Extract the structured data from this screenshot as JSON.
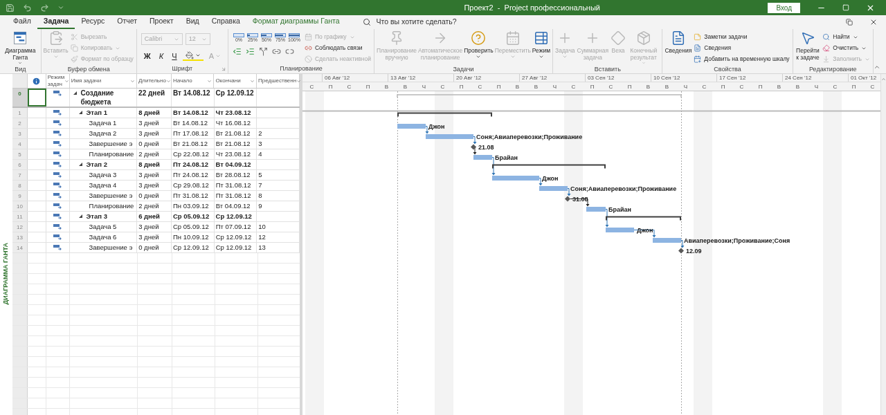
{
  "window": {
    "title": "Проект2  -  Project профессиональный",
    "sign_in": "Вход"
  },
  "tabs": [
    {
      "label": "Файл",
      "selected": false,
      "kind": "normal"
    },
    {
      "label": "Задача",
      "selected": true,
      "kind": "normal"
    },
    {
      "label": "Ресурс",
      "selected": false,
      "kind": "normal"
    },
    {
      "label": "Отчет",
      "selected": false,
      "kind": "normal"
    },
    {
      "label": "Проект",
      "selected": false,
      "kind": "normal"
    },
    {
      "label": "Вид",
      "selected": false,
      "kind": "normal"
    },
    {
      "label": "Справка",
      "selected": false,
      "kind": "normal"
    },
    {
      "label": "Формат диаграммы Ганта",
      "selected": false,
      "kind": "contextual"
    }
  ],
  "search": {
    "placeholder": "Что вы хотите сделать?"
  },
  "ribbon": {
    "groups": [
      {
        "label": "Вид",
        "items": [
          {
            "kind": "large",
            "label": "Диаграмма Ганта",
            "dropdown": true,
            "disabled": false
          }
        ]
      },
      {
        "label": "Буфер обмена",
        "items": [
          {
            "kind": "large",
            "label": "Вставить",
            "dropdown": true,
            "disabled": true
          },
          {
            "kind": "small",
            "label": "Вырезать",
            "disabled": true
          },
          {
            "kind": "small",
            "label": "Копировать",
            "dropdown": true,
            "disabled": true
          },
          {
            "kind": "small",
            "label": "Формат по образцу",
            "disabled": true
          }
        ]
      },
      {
        "label": "Шрифт",
        "launcher": true,
        "items": [
          {
            "kind": "select",
            "value": "Calibri",
            "disabled": true
          },
          {
            "kind": "select",
            "value": "12",
            "disabled": true
          },
          {
            "kind": "format",
            "label": "Ж",
            "disabled": false
          },
          {
            "kind": "format",
            "label": "К",
            "disabled": false
          },
          {
            "kind": "format",
            "label": "Ч",
            "disabled": false
          },
          {
            "kind": "fill",
            "dropdown": true,
            "disabled": false
          },
          {
            "kind": "format",
            "label": "A",
            "dropdown": true,
            "disabled": true
          }
        ]
      },
      {
        "label": "Планирование",
        "items": [
          {
            "kind": "pct",
            "label": "0%"
          },
          {
            "kind": "pct",
            "label": "25%"
          },
          {
            "kind": "pct",
            "label": "50%"
          },
          {
            "kind": "pct",
            "label": "75%"
          },
          {
            "kind": "pct",
            "label": "100%"
          },
          {
            "kind": "small",
            "label": "По графику",
            "dropdown": true,
            "disabled": true
          },
          {
            "kind": "small",
            "label": "Соблюдать связи",
            "disabled": false
          },
          {
            "kind": "small",
            "label": "Сделать неактивной",
            "disabled": true
          }
        ]
      },
      {
        "label": "Задачи",
        "items": [
          {
            "kind": "large",
            "label": "Планирование вручную",
            "disabled": true
          },
          {
            "kind": "large",
            "label": "Автоматическое планирование",
            "disabled": true
          },
          {
            "kind": "large",
            "label": "Проверить",
            "dropdown": true,
            "disabled": false
          },
          {
            "kind": "large",
            "label": "Переместить",
            "dropdown": true,
            "disabled": true
          },
          {
            "kind": "large",
            "label": "Режим",
            "dropdown": true,
            "disabled": false
          }
        ]
      },
      {
        "label": "Вставить",
        "items": [
          {
            "kind": "large",
            "label": "Задача",
            "dropdown": true,
            "disabled": true
          },
          {
            "kind": "large",
            "label": "Суммарная задача",
            "disabled": true
          },
          {
            "kind": "large",
            "label": "Веха",
            "disabled": true
          },
          {
            "kind": "large",
            "label": "Конечный результат",
            "dropdown": true,
            "disabled": true
          }
        ]
      },
      {
        "label": "Свойства",
        "items": [
          {
            "kind": "large",
            "label": "Сведения",
            "disabled": false
          },
          {
            "kind": "small",
            "label": "Заметки задачи",
            "disabled": false
          },
          {
            "kind": "small",
            "label": "Сведения",
            "disabled": false
          },
          {
            "kind": "small",
            "label": "Добавить на временную шкалу",
            "disabled": false
          }
        ]
      },
      {
        "label": "Редактирование",
        "items": [
          {
            "kind": "large",
            "label": "Перейти к задаче",
            "disabled": false
          },
          {
            "kind": "small",
            "label": "Найти",
            "dropdown": true,
            "disabled": false
          },
          {
            "kind": "small",
            "label": "Очистить",
            "dropdown": true,
            "disabled": false
          },
          {
            "kind": "small",
            "label": "Заполнить",
            "dropdown": true,
            "disabled": true
          }
        ]
      }
    ]
  },
  "view_bar": {
    "label": "ДИАГРАММА ГАНТА"
  },
  "table": {
    "columns": [
      {
        "label": "Режим задач"
      },
      {
        "label": "Имя задачи"
      },
      {
        "label": "Длительно"
      },
      {
        "label": "Начало"
      },
      {
        "label": "Окончани"
      },
      {
        "label": "Предшественн"
      }
    ],
    "rows": [
      {
        "id": "0",
        "name": "Создание бюджета",
        "duration": "22 дней",
        "start": "Вт 14.08.12",
        "finish": "Ср 12.09.12",
        "kind": "summary",
        "expanded": true,
        "selected": true,
        "children": [
          {
            "id": "1",
            "name": "Этап 1",
            "duration": "8 дней",
            "start": "Вт 14.08.12",
            "finish": "Чт 23.08.12",
            "kind": "summary",
            "expanded": true,
            "selected": false,
            "children": [
              {
                "id": "2",
                "name": "Задача 1",
                "duration": "3 дней",
                "start": "Вт 14.08.12",
                "finish": "Чт 16.08.12",
                "kind": "task",
                "bar_label": "Джон",
                "selected": false
              },
              {
                "id": "3",
                "name": "Задача 2",
                "duration": "3 дней",
                "start": "Пт 17.08.12",
                "finish": "Вт 21.08.12",
                "predecessors": "2",
                "kind": "task",
                "bar_label": "Соня;Авиаперевозки;Проживание",
                "selected": false
              },
              {
                "id": "4",
                "name": "Завершение э",
                "duration": "0 дней",
                "start": "Вт 21.08.12",
                "finish": "Вт 21.08.12",
                "predecessors": "3",
                "kind": "milestone",
                "bar_label": "21.08",
                "selected": false
              },
              {
                "id": "5",
                "name": "Планирование",
                "duration": "2 дней",
                "start": "Ср 22.08.12",
                "finish": "Чт 23.08.12",
                "predecessors": "4",
                "kind": "task",
                "bar_label": "Брайан",
                "selected": false
              }
            ]
          },
          {
            "id": "6",
            "name": "Этап 2",
            "duration": "8 дней",
            "start": "Пт 24.08.12",
            "finish": "Вт 04.09.12",
            "kind": "summary",
            "expanded": true,
            "selected": false,
            "children": [
              {
                "id": "7",
                "name": "Задача 3",
                "duration": "3 дней",
                "start": "Пт 24.08.12",
                "finish": "Вт 28.08.12",
                "predecessors": "5",
                "kind": "task",
                "bar_label": "Джон",
                "selected": false
              },
              {
                "id": "8",
                "name": "Задача 4",
                "duration": "3 дней",
                "start": "Ср 29.08.12",
                "finish": "Пт 31.08.12",
                "predecessors": "7",
                "kind": "task",
                "bar_label": "Соня;Авиаперевозки;Проживание",
                "selected": false
              },
              {
                "id": "9",
                "name": "Завершение э",
                "duration": "0 дней",
                "start": "Пт 31.08.12",
                "finish": "Пт 31.08.12",
                "predecessors": "8",
                "kind": "milestone",
                "bar_label": "31.08",
                "selected": false
              },
              {
                "id": "10",
                "name": "Планирование",
                "duration": "2 дней",
                "start": "Пн 03.09.12",
                "finish": "Вт 04.09.12",
                "predecessors": "9",
                "kind": "task",
                "bar_label": "Брайан",
                "selected": false
              }
            ]
          },
          {
            "id": "11",
            "name": "Этап 3",
            "duration": "6 дней",
            "start": "Ср 05.09.12",
            "finish": "Ср 12.09.12",
            "kind": "summary",
            "expanded": true,
            "selected": false,
            "children": [
              {
                "id": "12",
                "name": "Задача 5",
                "duration": "3 дней",
                "start": "Ср 05.09.12",
                "finish": "Пт 07.09.12",
                "predecessors": "10",
                "kind": "task",
                "bar_label": "Джон",
                "selected": false
              },
              {
                "id": "13",
                "name": "Задача 6",
                "duration": "3 дней",
                "start": "Пн 10.09.12",
                "finish": "Ср 12.09.12",
                "predecessors": "12",
                "kind": "task",
                "bar_label": "Авиаперевозки;Проживание;Соня",
                "selected": false
              },
              {
                "id": "14",
                "name": "Завершение э",
                "duration": "0 дней",
                "start": "Ср 12.09.12",
                "finish": "Ср 12.09.12",
                "predecessors": "13",
                "kind": "milestone",
                "bar_label": "12.09",
                "selected": false
              }
            ]
          }
        ]
      }
    ]
  },
  "timescale": {
    "weeks": [
      "06 Авг '12",
      "13 Авг '12",
      "20 Авг '12",
      "27 Авг '12",
      "03 Сен '12",
      "10 Сен '12",
      "17 Сен '12",
      "24 Сен '12",
      "01 Окт '12"
    ],
    "days": [
      "С",
      "П",
      "С",
      "П",
      "В",
      "В",
      "Ч",
      "С",
      "П",
      "С",
      "П",
      "В",
      "В",
      "Ч",
      "С",
      "П",
      "С",
      "П",
      "В",
      "В",
      "Ч",
      "С",
      "П",
      "С",
      "П",
      "В",
      "В",
      "Ч",
      "С",
      "П",
      "С"
    ]
  }
}
